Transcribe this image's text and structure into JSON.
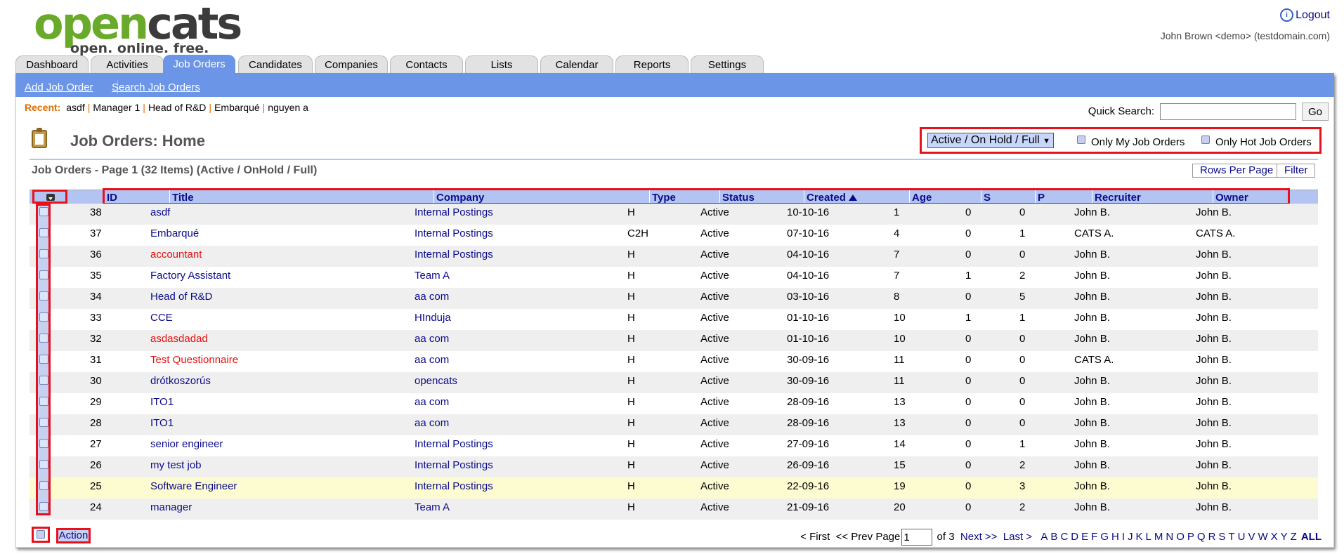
{
  "brand": {
    "word_green": "open",
    "word_dark": "cats",
    "tagline": "open. online. free."
  },
  "header": {
    "logout": "Logout",
    "user": "John Brown <demo> (testdomain.com)"
  },
  "tabs": [
    "Dashboard",
    "Activities",
    "Job Orders",
    "Candidates",
    "Companies",
    "Contacts",
    "Lists",
    "Calendar",
    "Reports",
    "Settings"
  ],
  "active_tab": "Job Orders",
  "subnav": {
    "add": "Add Job Order",
    "search": "Search Job Orders"
  },
  "recent": {
    "label": "Recent:",
    "items": [
      "asdf",
      "Manager 1",
      "Head of R&D",
      "Embarqué",
      "nguyen a"
    ]
  },
  "quick_search": {
    "label": "Quick Search:",
    "value": "",
    "go": "Go"
  },
  "page_title": "Job Orders: Home",
  "filters": {
    "select": "Active / On Hold / Full",
    "my_orders": "Only My Job Orders",
    "hot_orders": "Only Hot Job Orders"
  },
  "section_title": "Job Orders - Page 1 (32 Items) (Active / OnHold / Full)",
  "buttons": {
    "rows_per_page": "Rows Per Page",
    "filter": "Filter"
  },
  "columns": [
    "ID",
    "Title",
    "Company",
    "Type",
    "Status",
    "Created",
    "Age",
    "S",
    "P",
    "Recruiter",
    "Owner"
  ],
  "rows": [
    {
      "id": "38",
      "title": "asdf",
      "company": "Internal Postings",
      "type": "H",
      "status": "Active",
      "created": "10-10-16",
      "age": "1",
      "s": "0",
      "p": "0",
      "recruiter": "John B.",
      "owner": "John B.",
      "hot": false
    },
    {
      "id": "37",
      "title": "Embarqué",
      "company": "Internal Postings",
      "type": "C2H",
      "status": "Active",
      "created": "07-10-16",
      "age": "4",
      "s": "0",
      "p": "1",
      "recruiter": "CATS A.",
      "owner": "CATS A.",
      "hot": false
    },
    {
      "id": "36",
      "title": "accountant",
      "company": "Internal Postings",
      "type": "H",
      "status": "Active",
      "created": "04-10-16",
      "age": "7",
      "s": "0",
      "p": "0",
      "recruiter": "John B.",
      "owner": "John B.",
      "hot": true
    },
    {
      "id": "35",
      "title": "Factory Assistant",
      "company": "Team A",
      "type": "H",
      "status": "Active",
      "created": "04-10-16",
      "age": "7",
      "s": "1",
      "p": "2",
      "recruiter": "John B.",
      "owner": "John B.",
      "hot": false
    },
    {
      "id": "34",
      "title": "Head of R&D",
      "company": "aa com",
      "type": "H",
      "status": "Active",
      "created": "03-10-16",
      "age": "8",
      "s": "0",
      "p": "5",
      "recruiter": "John B.",
      "owner": "John B.",
      "hot": false
    },
    {
      "id": "33",
      "title": "CCE",
      "company": "HInduja",
      "type": "H",
      "status": "Active",
      "created": "01-10-16",
      "age": "10",
      "s": "1",
      "p": "1",
      "recruiter": "John B.",
      "owner": "John B.",
      "hot": false
    },
    {
      "id": "32",
      "title": "asdasdadad",
      "company": "aa com",
      "type": "H",
      "status": "Active",
      "created": "01-10-16",
      "age": "10",
      "s": "0",
      "p": "0",
      "recruiter": "John B.",
      "owner": "John B.",
      "hot": true
    },
    {
      "id": "31",
      "title": "Test Questionnaire",
      "company": "aa com",
      "type": "H",
      "status": "Active",
      "created": "30-09-16",
      "age": "11",
      "s": "0",
      "p": "0",
      "recruiter": "CATS A.",
      "owner": "John B.",
      "hot": true
    },
    {
      "id": "30",
      "title": "drótkoszorús",
      "company": "opencats",
      "type": "H",
      "status": "Active",
      "created": "30-09-16",
      "age": "11",
      "s": "0",
      "p": "0",
      "recruiter": "John B.",
      "owner": "John B.",
      "hot": false
    },
    {
      "id": "29",
      "title": "ITO1",
      "company": "aa com",
      "type": "H",
      "status": "Active",
      "created": "28-09-16",
      "age": "13",
      "s": "0",
      "p": "0",
      "recruiter": "John B.",
      "owner": "John B.",
      "hot": false
    },
    {
      "id": "28",
      "title": "ITO1",
      "company": "aa com",
      "type": "H",
      "status": "Active",
      "created": "28-09-16",
      "age": "13",
      "s": "0",
      "p": "0",
      "recruiter": "John B.",
      "owner": "John B.",
      "hot": false
    },
    {
      "id": "27",
      "title": "senior engineer",
      "company": "Internal Postings",
      "type": "H",
      "status": "Active",
      "created": "27-09-16",
      "age": "14",
      "s": "0",
      "p": "1",
      "recruiter": "John B.",
      "owner": "John B.",
      "hot": false
    },
    {
      "id": "26",
      "title": "my test job",
      "company": "Internal Postings",
      "type": "H",
      "status": "Active",
      "created": "26-09-16",
      "age": "15",
      "s": "0",
      "p": "2",
      "recruiter": "John B.",
      "owner": "John B.",
      "hot": false
    },
    {
      "id": "25",
      "title": "Software Engineer",
      "company": "Internal Postings",
      "type": "H",
      "status": "Active",
      "created": "22-09-16",
      "age": "19",
      "s": "0",
      "p": "3",
      "recruiter": "John B.",
      "owner": "John B.",
      "hot": false
    },
    {
      "id": "24",
      "title": "manager",
      "company": "Team A",
      "type": "H",
      "status": "Active",
      "created": "21-09-16",
      "age": "20",
      "s": "0",
      "p": "2",
      "recruiter": "John B.",
      "owner": "John B.",
      "hot": false
    }
  ],
  "pager": {
    "first": "< First",
    "prev": "<< Prev",
    "page_label": "Page",
    "page": "1",
    "of": "of 3",
    "next": "Next >>",
    "last": "Last >",
    "letters": [
      "A",
      "B",
      "C",
      "D",
      "E",
      "F",
      "G",
      "H",
      "I",
      "J",
      "K",
      "L",
      "M",
      "N",
      "O",
      "P",
      "Q",
      "R",
      "S",
      "T",
      "U",
      "V",
      "W",
      "X",
      "Y",
      "Z"
    ],
    "all": "ALL"
  },
  "footer": {
    "action": "Action"
  },
  "colors": {
    "accent": "#6b95e6",
    "link": "#0b0b8a",
    "hot": "#e60f0f",
    "highlight_box": "#e8111b"
  }
}
